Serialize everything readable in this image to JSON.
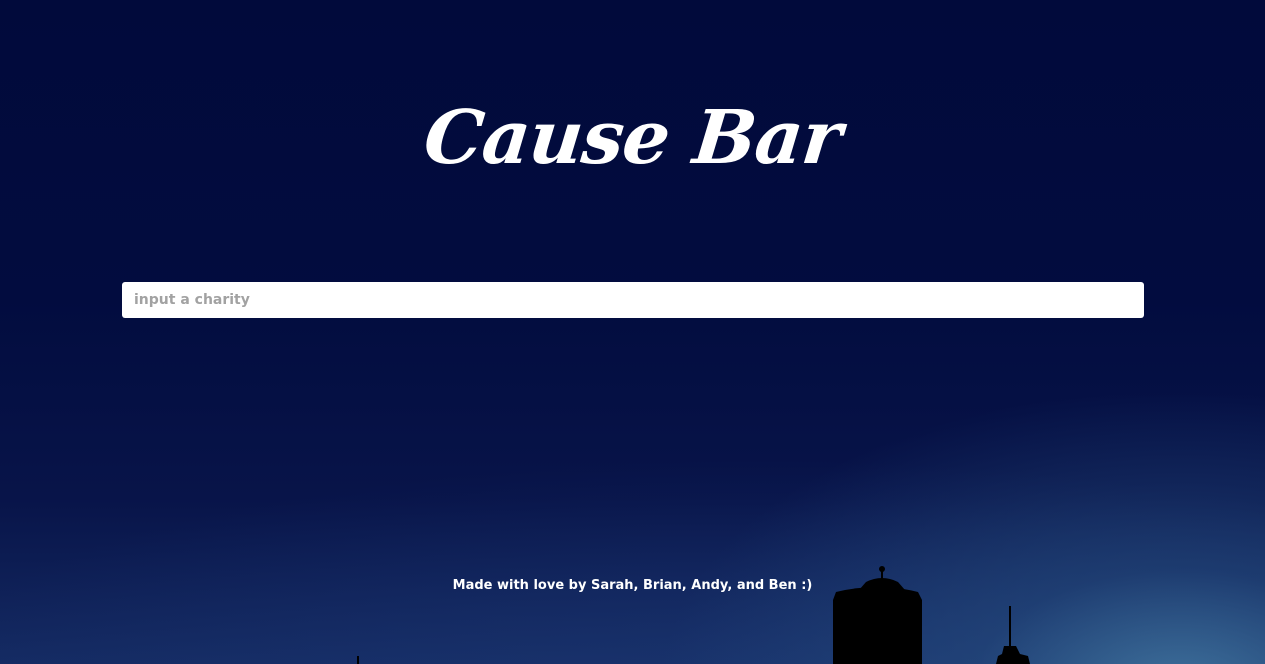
{
  "header": {
    "logo_text": "Cause Bar"
  },
  "search": {
    "placeholder": "input a charity",
    "value": ""
  },
  "footer": {
    "credit": "Made with love by Sarah, Brian, Andy, and Ben :)"
  },
  "colors": {
    "sky_top": "#010a3b",
    "sky_glow": "#467da5",
    "text": "#ffffff",
    "input_bg": "#ffffff",
    "placeholder": "#a2a2a2"
  }
}
